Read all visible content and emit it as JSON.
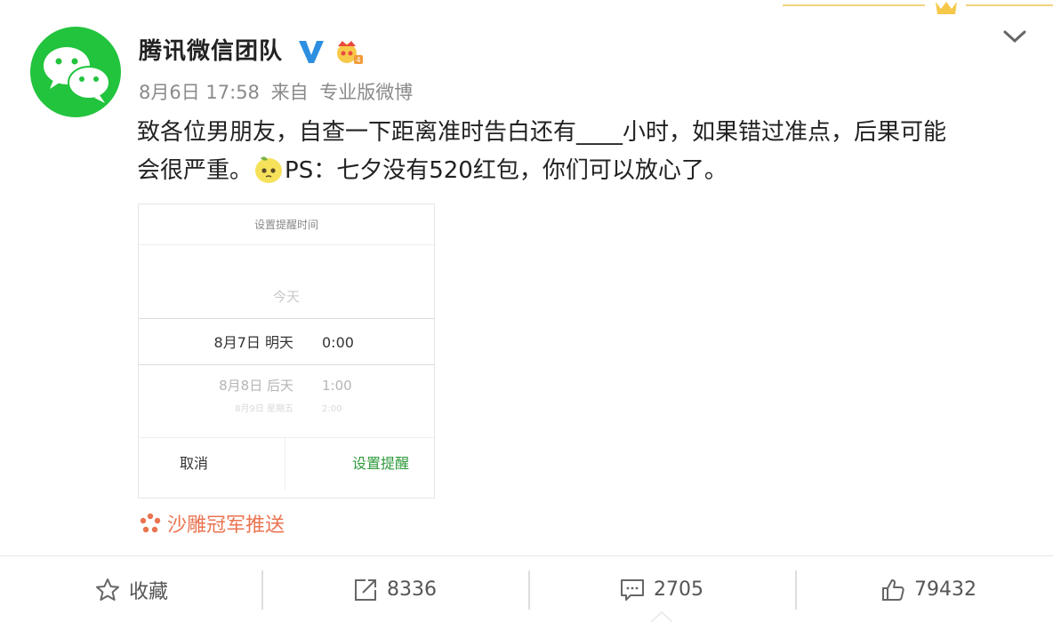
{
  "post": {
    "author": "腾讯微信团队",
    "date": "8月6日 17:58",
    "from_label": "来自",
    "client": "专业版微博",
    "text_line1": "致各位男朋友，自查一下距离准时告白还有____小时，如果错过准点，后果可能",
    "text_line2_a": "会很严重。",
    "text_line2_b": "PS：七夕没有520红包，你们可以放心了。",
    "source_text": "沙雕冠军推送"
  },
  "screenshot": {
    "title": "设置提醒时间",
    "today": "今天",
    "selected_date": "8月7日 明天",
    "selected_time": "0:00",
    "next_date": "8月8日 后天",
    "next_time": "1:00",
    "faded_date": "8月9日 星期五",
    "faded_time": "2:00",
    "cancel": "取消",
    "confirm": "设置提醒"
  },
  "actions": {
    "favorite": "收藏",
    "repost": "8336",
    "comment": "2705",
    "like": "79432"
  },
  "icons": {
    "avatar": "wechat-logo-icon",
    "verified": "verified-v-icon",
    "member": "crown-member-icon",
    "menu": "chevron-down-icon",
    "emoji": "lemon-emoji-icon",
    "source": "source-flower-icon",
    "favorite": "star-icon",
    "repost": "share-icon",
    "comment": "comment-icon",
    "like": "thumbs-up-icon"
  },
  "colors": {
    "wechat_green": "#22c33d",
    "verified_blue": "#2d8fe0",
    "source_orange": "#eb7350",
    "confirm_green": "#2e9a3b"
  }
}
